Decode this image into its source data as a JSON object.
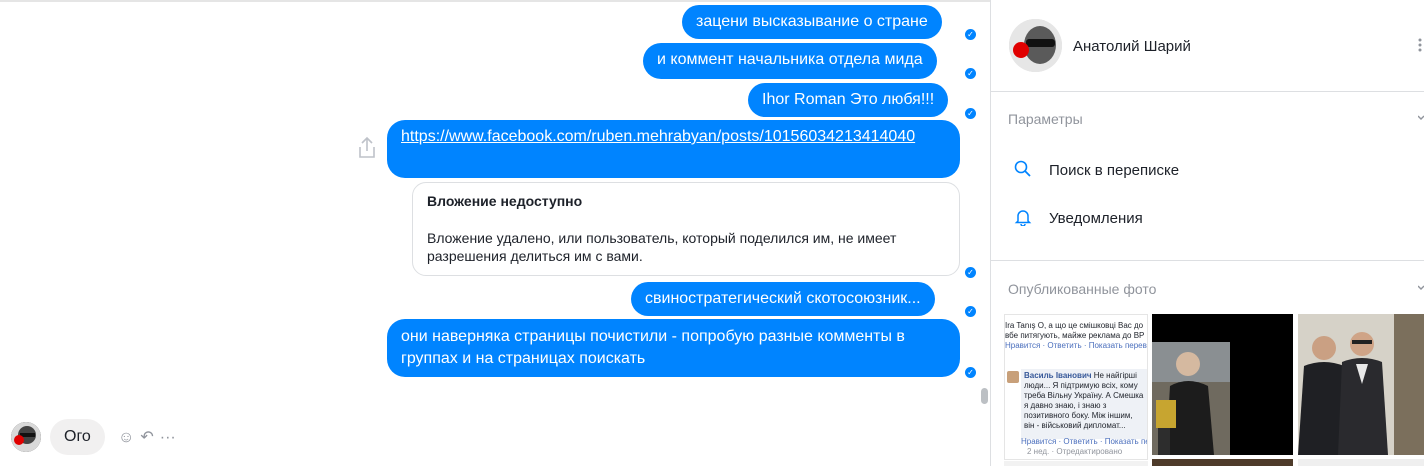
{
  "messages": {
    "m1": "зацени высказывание о стране",
    "m2": "и коммент начальника отдела мида",
    "m3": "Ihor Roman Это любя!!!",
    "m4_link": "https://www.facebook.com/ruben.mehrabyan/posts/10156034213414040",
    "attachment": {
      "title": "Вложение недоступно",
      "body": "Вложение удалено, или пользователь, который поделился им, не имеет разрешения делиться им с вами."
    },
    "m5": "свиностратегический скотосоюзник...",
    "m6": "они наверняка страницы почистили - попробую разные комменты в группах и на страницах поискать",
    "incoming": "Ого"
  },
  "panel": {
    "contact_name": "Анатолий Шарий",
    "params_title": "Параметры",
    "options": [
      {
        "label": "Поиск в переписке",
        "icon": "search-icon"
      },
      {
        "label": "Уведомления",
        "icon": "bell-icon"
      }
    ],
    "photos_title": "Опубликованные фото",
    "photo1": {
      "line1": "Ira Tanış О, а що це смішковці Вас до",
      "line2": "вбе питягують, майже реклама до ВР",
      "line3": "Нравится · Ответить · Показать перевод",
      "name": "Василь Іванович",
      "comment": "Не найгірші люди... Я підтримую всіх, кому треба Вільну Україну. А Смешка я давно знаю, і знаю з позитивного боку. Між іншим, він - військовий дипломат...",
      "actions": "Нравится · Ответить · Показать перевод",
      "meta": "2 нед. · Отредактировано"
    }
  },
  "colors": {
    "bubble": "#0084ff",
    "incoming_bg": "#f1f0f0",
    "muted": "#90949c"
  }
}
